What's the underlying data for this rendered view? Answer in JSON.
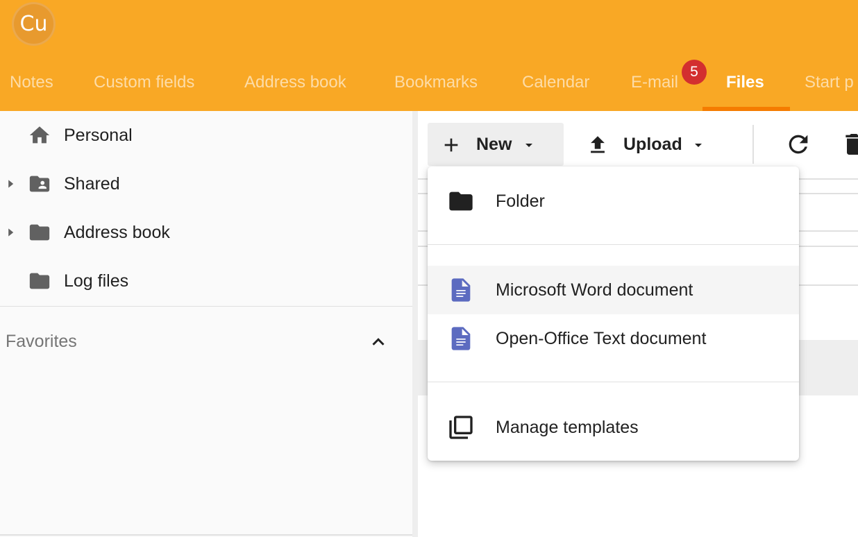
{
  "header": {
    "avatar_text": "Cu",
    "tabs": [
      {
        "label": "Notes"
      },
      {
        "label": "Custom fields"
      },
      {
        "label": "Address book"
      },
      {
        "label": "Bookmarks"
      },
      {
        "label": "Calendar"
      },
      {
        "label": "E-mail"
      },
      {
        "label": "Files"
      },
      {
        "label": "Start p"
      }
    ],
    "active_tab": "Files",
    "email_badge": "5",
    "colors": {
      "bar": "#f9a825",
      "active_underline": "#f57c00",
      "badge": "#d32f2f"
    }
  },
  "sidebar": {
    "items": [
      {
        "label": "Personal",
        "icon": "home-icon",
        "expandable": false
      },
      {
        "label": "Shared",
        "icon": "shared-folder-icon",
        "expandable": true
      },
      {
        "label": "Address book",
        "icon": "folder-icon",
        "expandable": true
      },
      {
        "label": "Log files",
        "icon": "folder-icon",
        "expandable": false
      }
    ],
    "favorites_label": "Favorites"
  },
  "toolbar": {
    "new_label": "New",
    "upload_label": "Upload"
  },
  "new_menu": {
    "items": [
      {
        "label": "Folder",
        "icon": "folder-icon"
      },
      {
        "label": "Microsoft Word document",
        "icon": "document-icon",
        "highlighted": true
      },
      {
        "label": "Open-Office Text document",
        "icon": "document-icon"
      },
      {
        "label": "Manage templates",
        "icon": "templates-icon"
      }
    ]
  }
}
